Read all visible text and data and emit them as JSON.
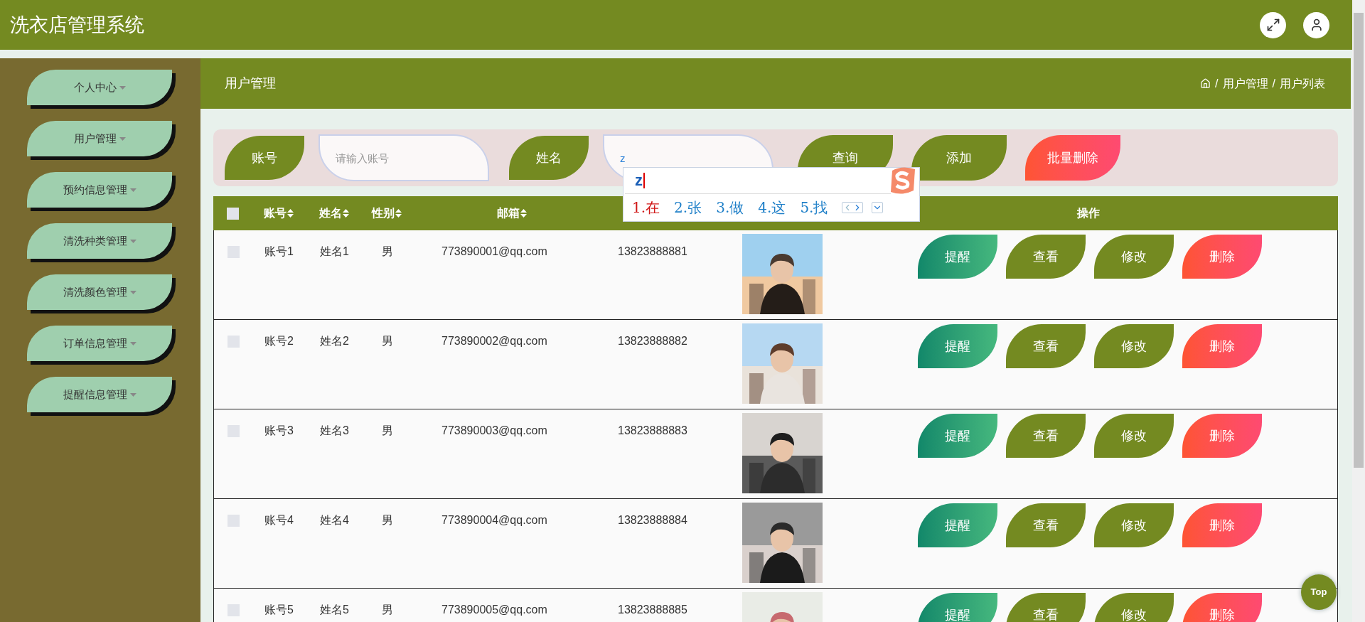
{
  "header": {
    "title": "洗衣店管理系统"
  },
  "sidebar": {
    "items": [
      {
        "label": "个人中心"
      },
      {
        "label": "用户管理"
      },
      {
        "label": "预约信息管理"
      },
      {
        "label": "清洗种类管理"
      },
      {
        "label": "清洗颜色管理"
      },
      {
        "label": "订单信息管理"
      },
      {
        "label": "提醒信息管理"
      }
    ]
  },
  "page": {
    "title": "用户管理",
    "breadcrumb": [
      {
        "sep": "/",
        "label": "用户管理"
      },
      {
        "sep": "/",
        "label": "用户列表"
      }
    ]
  },
  "search": {
    "fields": [
      {
        "label": "账号",
        "placeholder": "请输入账号"
      },
      {
        "label": "姓名",
        "value": "z"
      }
    ],
    "buttons": [
      {
        "label": "查询",
        "kind": "primary"
      },
      {
        "label": "添加",
        "kind": "primary"
      },
      {
        "label": "批量删除",
        "kind": "danger"
      }
    ]
  },
  "ime": {
    "composition": "z",
    "candidates": [
      {
        "label": "1.在",
        "selected": true
      },
      {
        "label": "2.张",
        "selected": false
      },
      {
        "label": "3.做",
        "selected": false
      },
      {
        "label": "4.这",
        "selected": false
      },
      {
        "label": "5.找",
        "selected": false
      }
    ]
  },
  "table": {
    "select_all": {
      "checked": false
    },
    "columns": [
      {
        "label": "账号",
        "sortable": true
      },
      {
        "label": "姓名",
        "sortable": true
      },
      {
        "label": "性别",
        "sortable": true
      },
      {
        "label": "邮箱",
        "sortable": true
      },
      {
        "label": "操作",
        "sortable": false
      }
    ],
    "rows": [
      {
        "checked": false,
        "account": "账号1",
        "name": "姓名1",
        "gender": "男",
        "email": "773890001@qq.com",
        "phone": "13823888881",
        "photo": {
          "kind": "picture"
        },
        "actions": [
          {
            "label": "提醒",
            "kind": "remind"
          },
          {
            "label": "查看",
            "kind": "view"
          },
          {
            "label": "修改",
            "kind": "edit"
          },
          {
            "label": "删除",
            "kind": "delete"
          }
        ]
      },
      {
        "checked": false,
        "account": "账号2",
        "name": "姓名2",
        "gender": "男",
        "email": "773890002@qq.com",
        "phone": "13823888882",
        "photo": {
          "kind": "picture"
        },
        "actions": [
          {
            "label": "提醒",
            "kind": "remind"
          },
          {
            "label": "查看",
            "kind": "view"
          },
          {
            "label": "修改",
            "kind": "edit"
          },
          {
            "label": "删除",
            "kind": "delete"
          }
        ]
      },
      {
        "checked": false,
        "account": "账号3",
        "name": "姓名3",
        "gender": "男",
        "email": "773890003@qq.com",
        "phone": "13823888883",
        "photo": {
          "kind": "picture"
        },
        "actions": [
          {
            "label": "提醒",
            "kind": "remind"
          },
          {
            "label": "查看",
            "kind": "view"
          },
          {
            "label": "修改",
            "kind": "edit"
          },
          {
            "label": "删除",
            "kind": "delete"
          }
        ]
      },
      {
        "checked": false,
        "account": "账号4",
        "name": "姓名4",
        "gender": "男",
        "email": "773890004@qq.com",
        "phone": "13823888884",
        "photo": {
          "kind": "picture"
        },
        "actions": [
          {
            "label": "提醒",
            "kind": "remind"
          },
          {
            "label": "查看",
            "kind": "view"
          },
          {
            "label": "修改",
            "kind": "edit"
          },
          {
            "label": "删除",
            "kind": "delete"
          }
        ]
      },
      {
        "checked": false,
        "account": "账号5",
        "name": "姓名5",
        "gender": "男",
        "email": "773890005@qq.com",
        "phone": "13823888885",
        "photo": {
          "kind": "picture"
        },
        "actions": [
          {
            "label": "提醒",
            "kind": "remind"
          },
          {
            "label": "查看",
            "kind": "view"
          },
          {
            "label": "修改",
            "kind": "edit"
          },
          {
            "label": "删除",
            "kind": "delete"
          }
        ]
      }
    ]
  },
  "back_to_top": {
    "label": "Top"
  }
}
